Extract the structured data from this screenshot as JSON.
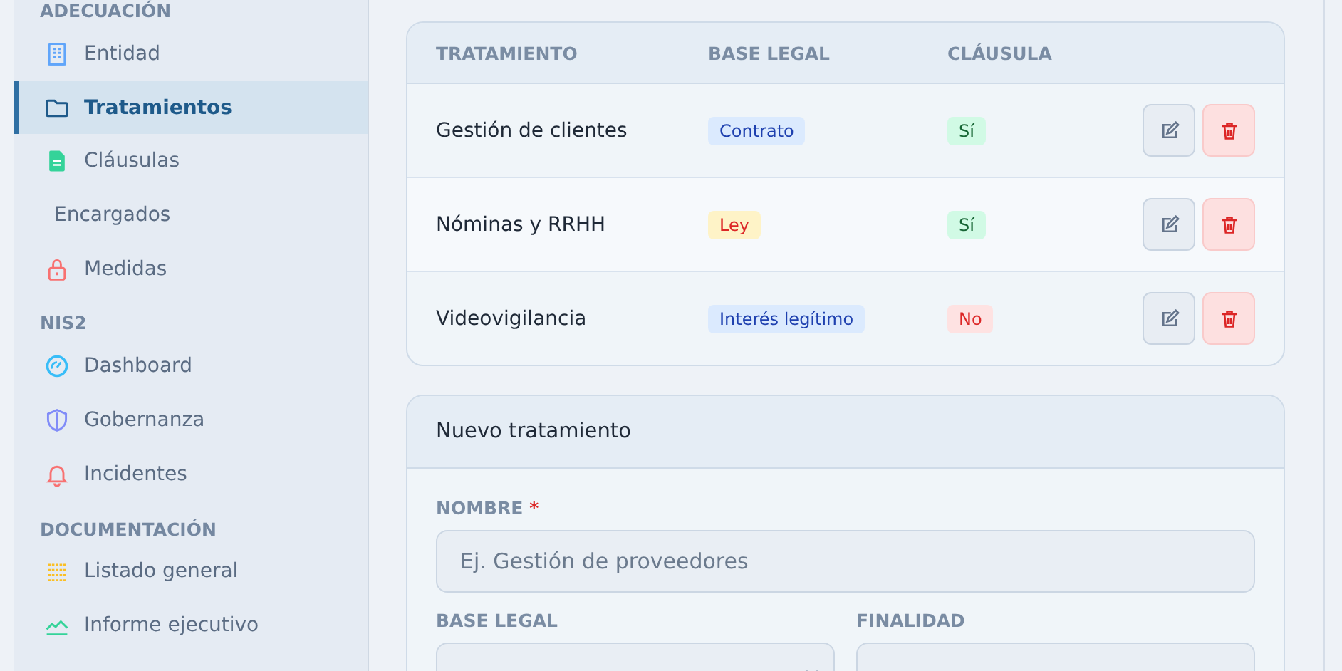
{
  "sidebar": {
    "sections": [
      {
        "title": "ADECUACIÓN",
        "items": [
          {
            "label": "Entidad",
            "selected": false
          },
          {
            "label": "Tratamientos",
            "selected": true
          },
          {
            "label": "Cláusulas",
            "selected": false
          },
          {
            "label": "Encargados",
            "selected": false
          },
          {
            "label": "Medidas",
            "selected": false
          }
        ]
      },
      {
        "title": "NIS2",
        "items": [
          {
            "label": "Dashboard",
            "selected": false
          },
          {
            "label": "Gobernanza",
            "selected": false
          },
          {
            "label": "Incidentes",
            "selected": false
          }
        ]
      },
      {
        "title": "DOCUMENTACIÓN",
        "items": [
          {
            "label": "Listado general",
            "selected": false
          },
          {
            "label": "Informe ejecutivo",
            "selected": false
          }
        ]
      }
    ]
  },
  "table": {
    "columns": [
      "TRATAMIENTO",
      "BASE LEGAL",
      "CLÁUSULA"
    ],
    "rows": [
      {
        "name": "Gestión de clientes",
        "base_legal": {
          "text": "Contrato",
          "kind": "blue"
        },
        "clausula": {
          "text": "Sí",
          "ok": true
        }
      },
      {
        "name": "Nóminas y RRHH",
        "base_legal": {
          "text": "Ley",
          "kind": "yellow"
        },
        "clausula": {
          "text": "Sí",
          "ok": true
        }
      },
      {
        "name": "Videovigilancia",
        "base_legal": {
          "text": "Interés legítimo",
          "kind": "blue"
        },
        "clausula": {
          "text": "No",
          "ok": false
        }
      }
    ]
  },
  "form": {
    "title": "Nuevo tratamiento",
    "fields": [
      {
        "label": "NOMBRE",
        "required_mark": "*",
        "kind": "text",
        "placeholder": "Ej. Gestión de proveedores"
      },
      {
        "label": "BASE LEGAL",
        "kind": "select"
      },
      {
        "label": "FINALIDAD",
        "kind": "text"
      }
    ]
  }
}
